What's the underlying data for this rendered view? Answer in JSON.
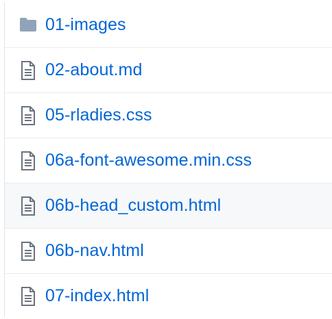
{
  "colors": {
    "link": "#0366d6",
    "folder_icon": "#79b8ff",
    "file_icon": "#6a737d",
    "hover_row": "#f6f8fa",
    "border": "#eaecef"
  },
  "files": [
    {
      "name": "01-images",
      "icon": "folder-icon",
      "hovered": false
    },
    {
      "name": "02-about.md",
      "icon": "file-icon",
      "hovered": false
    },
    {
      "name": "05-rladies.css",
      "icon": "file-icon",
      "hovered": false
    },
    {
      "name": "06a-font-awesome.min.css",
      "icon": "file-icon",
      "hovered": false
    },
    {
      "name": "06b-head_custom.html",
      "icon": "file-icon",
      "hovered": true
    },
    {
      "name": "06b-nav.html",
      "icon": "file-icon",
      "hovered": false
    },
    {
      "name": "07-index.html",
      "icon": "file-icon",
      "hovered": false
    }
  ]
}
